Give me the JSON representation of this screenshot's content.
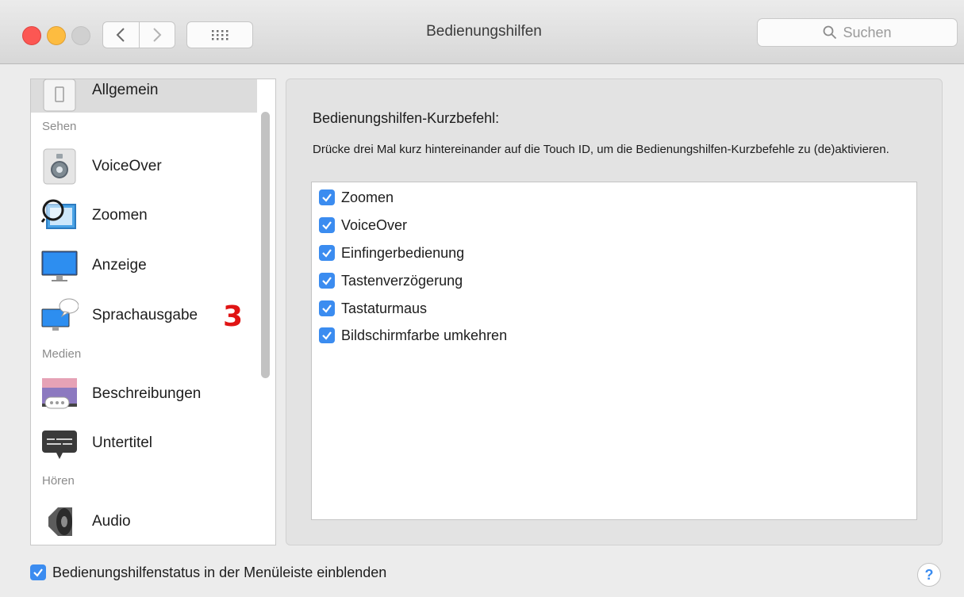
{
  "window": {
    "title": "Bedienungshilfen"
  },
  "toolbar": {
    "back_icon": "chevron-left-icon",
    "forward_icon": "chevron-right-icon",
    "show_all_icon": "grid-icon",
    "search_placeholder": "Suchen"
  },
  "sidebar": {
    "items": [
      {
        "label": "Allgemein",
        "icon": "general-icon",
        "selected": true
      },
      {
        "label": "VoiceOver",
        "icon": "voiceover-icon"
      },
      {
        "label": "Zoomen",
        "icon": "zoom-icon"
      },
      {
        "label": "Anzeige",
        "icon": "display-icon"
      },
      {
        "label": "Sprachausgabe",
        "icon": "speech-icon"
      },
      {
        "label": "Beschreibungen",
        "icon": "descriptions-icon"
      },
      {
        "label": "Untertitel",
        "icon": "captions-icon"
      },
      {
        "label": "Audio",
        "icon": "audio-icon"
      }
    ],
    "sections": {
      "sehen": "Sehen",
      "medien": "Medien",
      "hoeren": "Hören"
    },
    "annotation": "3"
  },
  "main": {
    "heading": "Bedienungshilfen-Kurzbefehl:",
    "description": "Drücke drei Mal kurz hintereinander auf die Touch ID, um die Bedienungshilfen-Kurzbefehle zu (de)aktivieren.",
    "options": [
      {
        "label": "Zoomen",
        "checked": true
      },
      {
        "label": "VoiceOver",
        "checked": true
      },
      {
        "label": "Einfingerbedienung",
        "checked": true
      },
      {
        "label": "Tastenverzögerung",
        "checked": true
      },
      {
        "label": "Tastaturmaus",
        "checked": true
      },
      {
        "label": "Bildschirmfarbe umkehren",
        "checked": true
      }
    ]
  },
  "footer": {
    "status_label": "Bedienungshilfenstatus in der Menüleiste einblenden",
    "status_checked": true,
    "help_label": "?"
  },
  "colors": {
    "accent": "#3b8cf0",
    "annotation": "#e01414"
  }
}
